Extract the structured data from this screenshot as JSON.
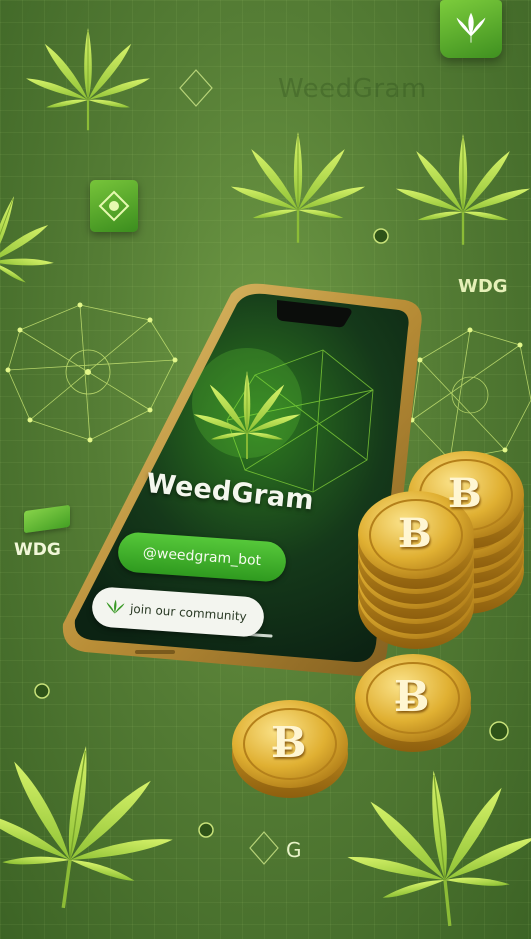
{
  "watermark": "WeedGram",
  "labels": {
    "wdg_top": "WDG",
    "wdg_left": "WDG",
    "g_bottom": "G"
  },
  "phone": {
    "app_name": "WeedGram",
    "bot_handle": "@weedgram_bot",
    "community_label": "join our community"
  },
  "coin_symbol": "Ƀ",
  "colors": {
    "background": "#557d35",
    "accent_green": "#3fae24",
    "leaf": "#b5e04a",
    "coin_gold": "#d9a520",
    "phone_frame": "#c9a24a"
  },
  "icons": [
    "cannabis-leaf-icon",
    "coin-icon",
    "app-logo-icon",
    "network-icon"
  ]
}
